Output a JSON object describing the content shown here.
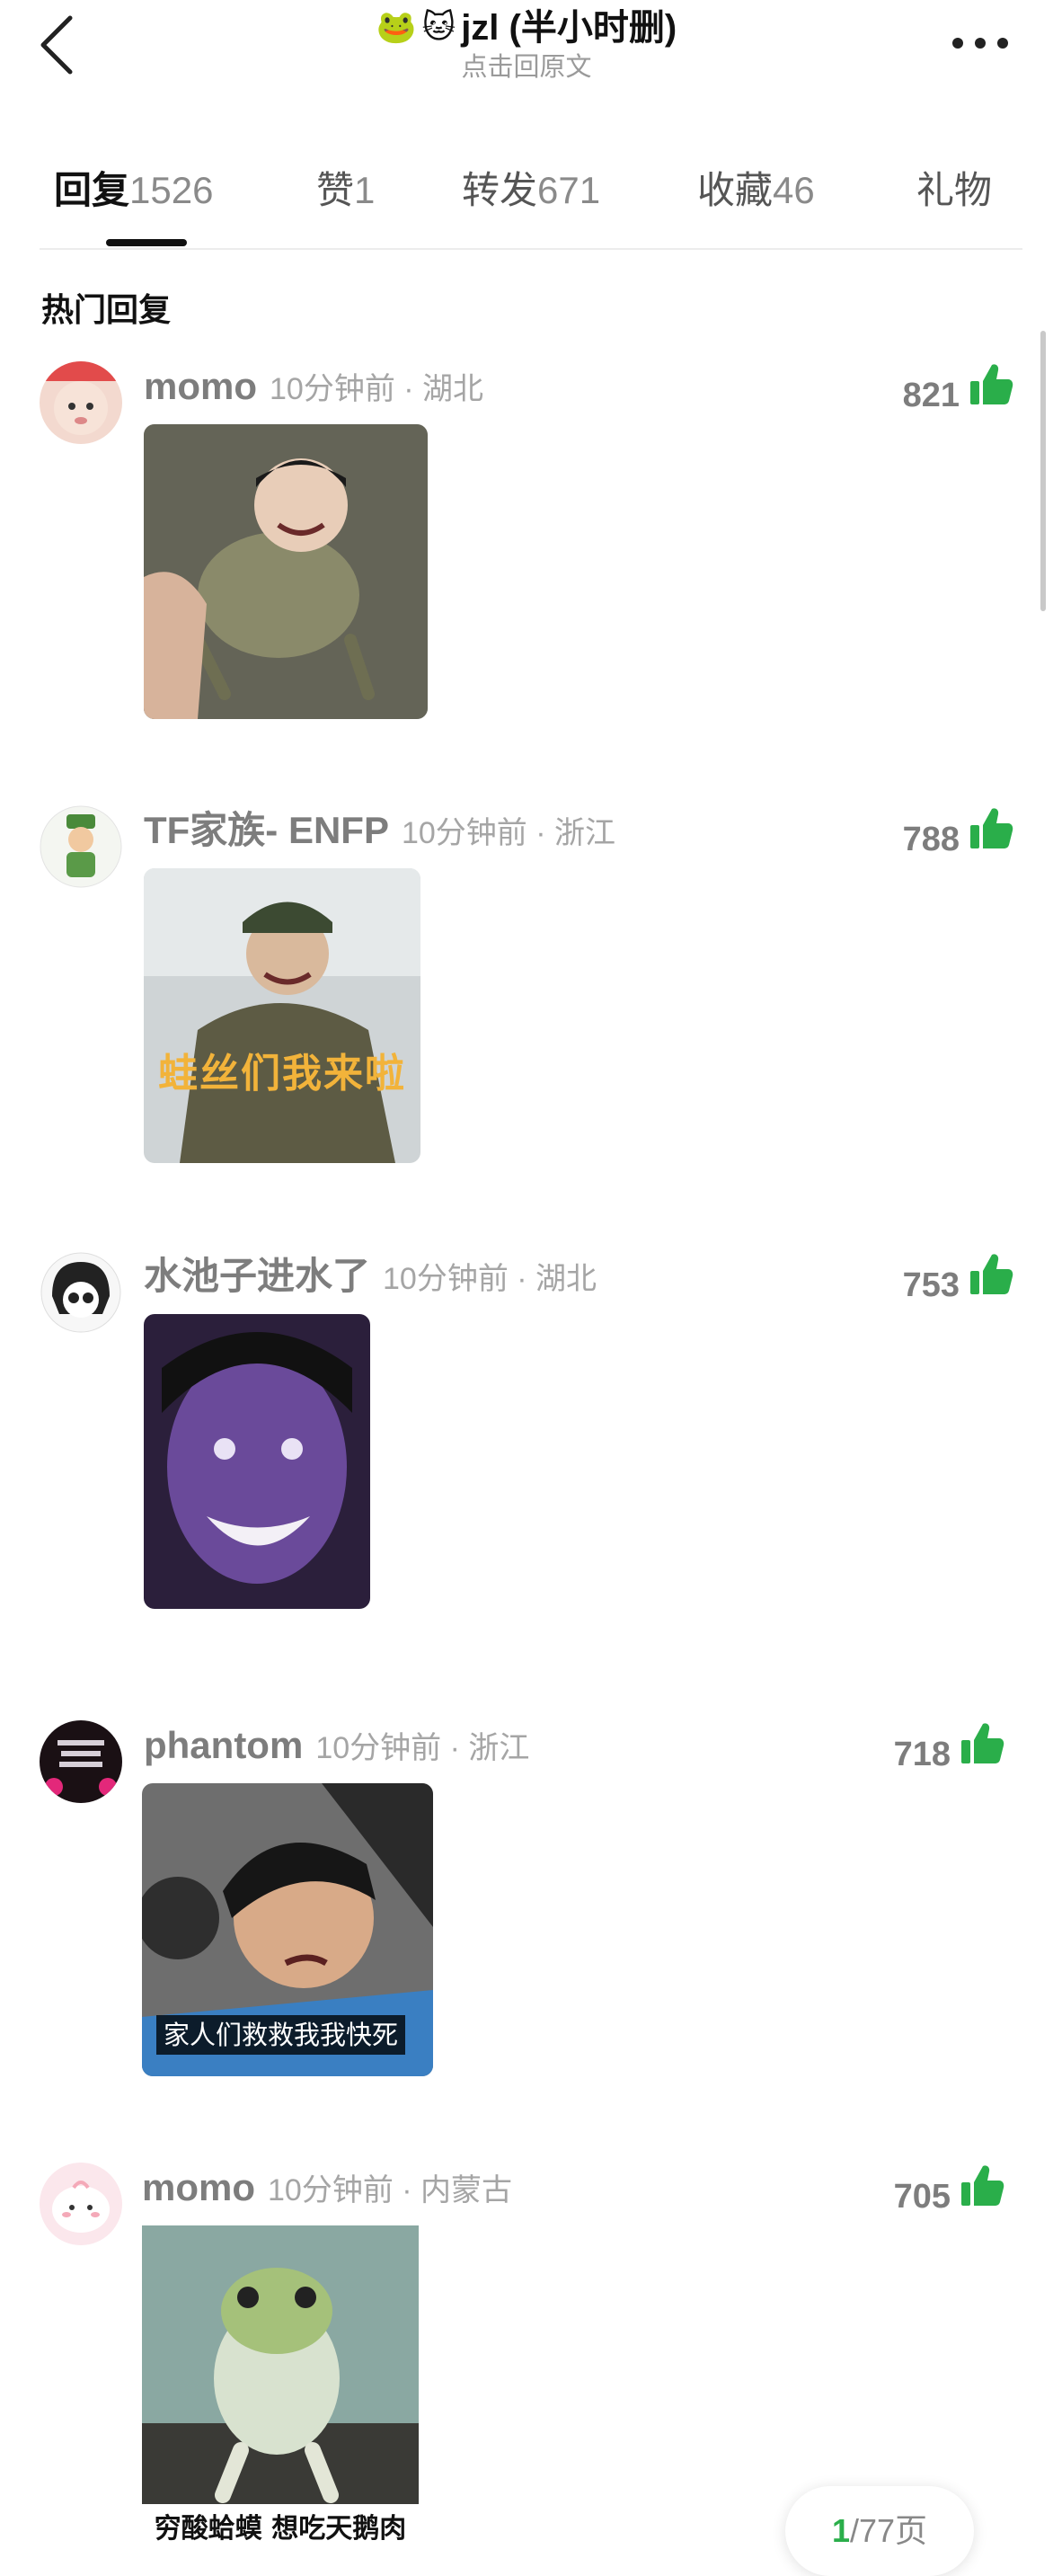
{
  "header": {
    "title": "jzl (半小时删)",
    "title_emojis": [
      "frog-face",
      "cat-face"
    ],
    "subtitle": "点击回原文"
  },
  "tabs": [
    {
      "label": "回复",
      "count": "1526",
      "active": true
    },
    {
      "label": "赞",
      "count": "1",
      "active": false
    },
    {
      "label": "转发",
      "count": "671",
      "active": false
    },
    {
      "label": "收藏",
      "count": "46",
      "active": false
    },
    {
      "label": "礼物",
      "count": "",
      "active": false
    }
  ],
  "section_title": "热门回复",
  "comments": [
    {
      "username": "momo",
      "meta": "10分钟前 · 湖北",
      "likes": "821",
      "sticker_caption": ""
    },
    {
      "username": "TF家族- ENFP",
      "meta": "10分钟前 · 浙江",
      "likes": "788",
      "sticker_caption": "蛙丝们我来啦"
    },
    {
      "username": "水池子进水了",
      "meta": "10分钟前 · 湖北",
      "likes": "753",
      "sticker_caption": ""
    },
    {
      "username": "phantom",
      "meta": "10分钟前 · 浙江",
      "likes": "718",
      "sticker_caption": "家人们救救我我快死"
    },
    {
      "username": "momo",
      "meta": "10分钟前 · 内蒙古",
      "likes": "705",
      "sticker_caption": "穷酸蛤蟆 想吃天鹅肉"
    }
  ],
  "pager": {
    "current": "1",
    "total_text": "/77页"
  },
  "colors": {
    "like_green": "#2aae4a",
    "text_gray": "#7d7d7d"
  }
}
